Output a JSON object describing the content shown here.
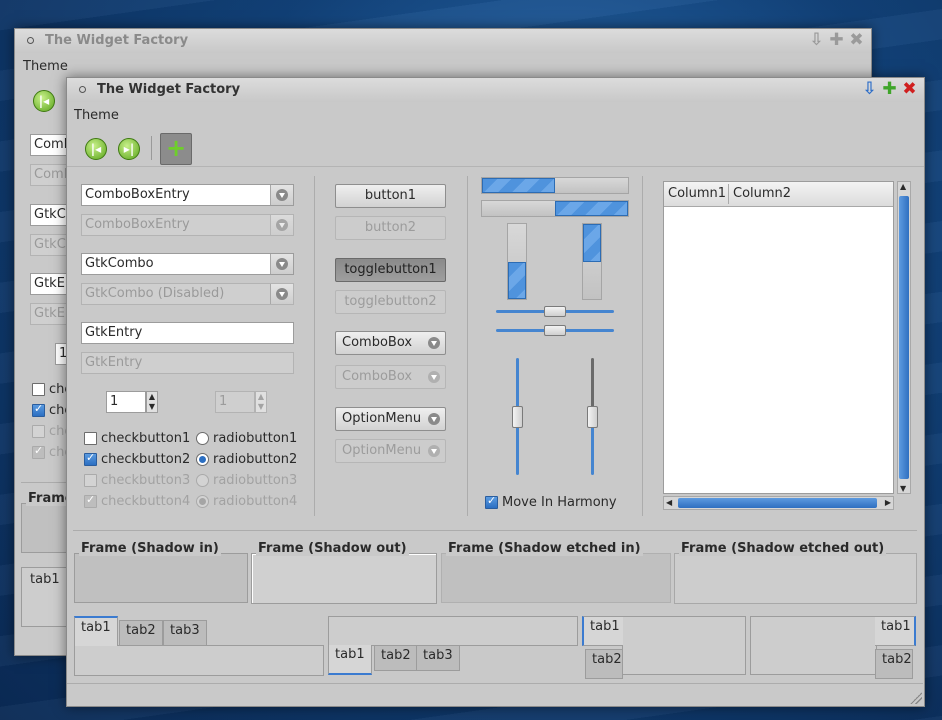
{
  "back_window": {
    "title": "The Widget Factory",
    "menu_theme": "Theme",
    "entries": [
      "Comb",
      "Comb",
      "GtkCo",
      "GtkCo",
      "GtkEn",
      "GtkEn"
    ],
    "spin_value": "1",
    "checks": [
      "chec",
      "chec",
      "chec",
      "chec"
    ],
    "frame_label": "Frame",
    "tab_label": "tab1"
  },
  "main_window": {
    "title": "The Widget Factory",
    "menu_theme": "Theme",
    "combobox_entry": "ComboBoxEntry",
    "combobox_entry_disabled": "ComboBoxEntry",
    "gtkcombo": "GtkCombo",
    "gtkcombo_disabled": "GtkCombo (Disabled)",
    "gtkentry": "GtkEntry",
    "gtkentry_disabled_placeholder": "GtkEntry",
    "spin_value": "1",
    "spin_disabled_value": "1",
    "checkbuttons": [
      {
        "label": "checkbutton1",
        "checked": false,
        "disabled": false
      },
      {
        "label": "checkbutton2",
        "checked": true,
        "disabled": false
      },
      {
        "label": "checkbutton3",
        "checked": false,
        "disabled": true
      },
      {
        "label": "checkbutton4",
        "checked": true,
        "disabled": true
      }
    ],
    "radiobuttons": [
      {
        "label": "radiobutton1",
        "checked": false,
        "disabled": false
      },
      {
        "label": "radiobutton2",
        "checked": true,
        "disabled": false
      },
      {
        "label": "radiobutton3",
        "checked": false,
        "disabled": true
      },
      {
        "label": "radiobutton4",
        "checked": true,
        "disabled": true
      }
    ],
    "button1": "button1",
    "button2": "button2",
    "togglebutton1": "togglebutton1",
    "togglebutton2": "togglebutton2",
    "combobox": "ComboBox",
    "combobox_disabled": "ComboBox",
    "optionmenu": "OptionMenu",
    "optionmenu_disabled": "OptionMenu",
    "progress": {
      "h1": 0.5,
      "h2": 0.5,
      "v1": 0.5,
      "v2": 0.5
    },
    "sliders": {
      "h1": 0.5,
      "h2": 0.5,
      "v1": 0.5,
      "v2": 0.5
    },
    "move_in_harmony": "Move In Harmony",
    "tree_columns": [
      "Column1",
      "Column2"
    ],
    "frames": [
      "Frame (Shadow in)",
      "Frame (Shadow out)",
      "Frame (Shadow etched in)",
      "Frame (Shadow etched out)"
    ],
    "notebooks": {
      "top": [
        "tab1",
        "tab2",
        "tab3"
      ],
      "bottom": [
        "tab1",
        "tab2",
        "tab3"
      ],
      "left": [
        "tab1",
        "tab2"
      ],
      "right": [
        "tab1",
        "tab2"
      ]
    }
  },
  "colors": {
    "accent": "#3b7bd0",
    "window_bg": "#c9c9c9",
    "desktop": "#1a4f8a",
    "close": "#d02020",
    "maximize": "#3fa52a",
    "minimize": "#2f6fc8"
  }
}
